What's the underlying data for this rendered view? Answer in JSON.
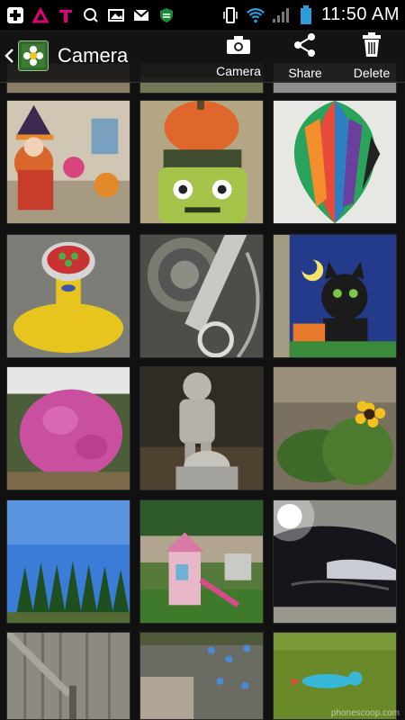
{
  "status_bar": {
    "time": "11:50 AM",
    "icons": [
      "plus-icon",
      "tmobile-signal-icon",
      "tmobile-icon",
      "q-icon",
      "gallery-icon",
      "gmail-icon",
      "shield-icon",
      "vibrate-icon",
      "wifi-icon",
      "signal-icon",
      "battery-icon"
    ]
  },
  "action_bar": {
    "title": "Camera",
    "camera_label": "Camera",
    "share_label": "Share",
    "delete_label": "Delete"
  },
  "photos": [
    {
      "subject": "witch-doll"
    },
    {
      "subject": "pumpkin-frankenstein"
    },
    {
      "subject": "striped-balloon"
    },
    {
      "subject": "yellow-toy"
    },
    {
      "subject": "bicycle-gears"
    },
    {
      "subject": "black-cat-flag"
    },
    {
      "subject": "pink-mums"
    },
    {
      "subject": "stone-statue"
    },
    {
      "subject": "black-eyed-susans"
    },
    {
      "subject": "evergreen-trees"
    },
    {
      "subject": "playhouse"
    },
    {
      "subject": "black-car"
    },
    {
      "subject": "barn-door"
    },
    {
      "subject": "rock-garden"
    },
    {
      "subject": "blue-bowling-pin"
    }
  ],
  "watermark": "phonescoop.com",
  "colors": {
    "accent": "#2f9bd7",
    "bar": "#141414"
  }
}
